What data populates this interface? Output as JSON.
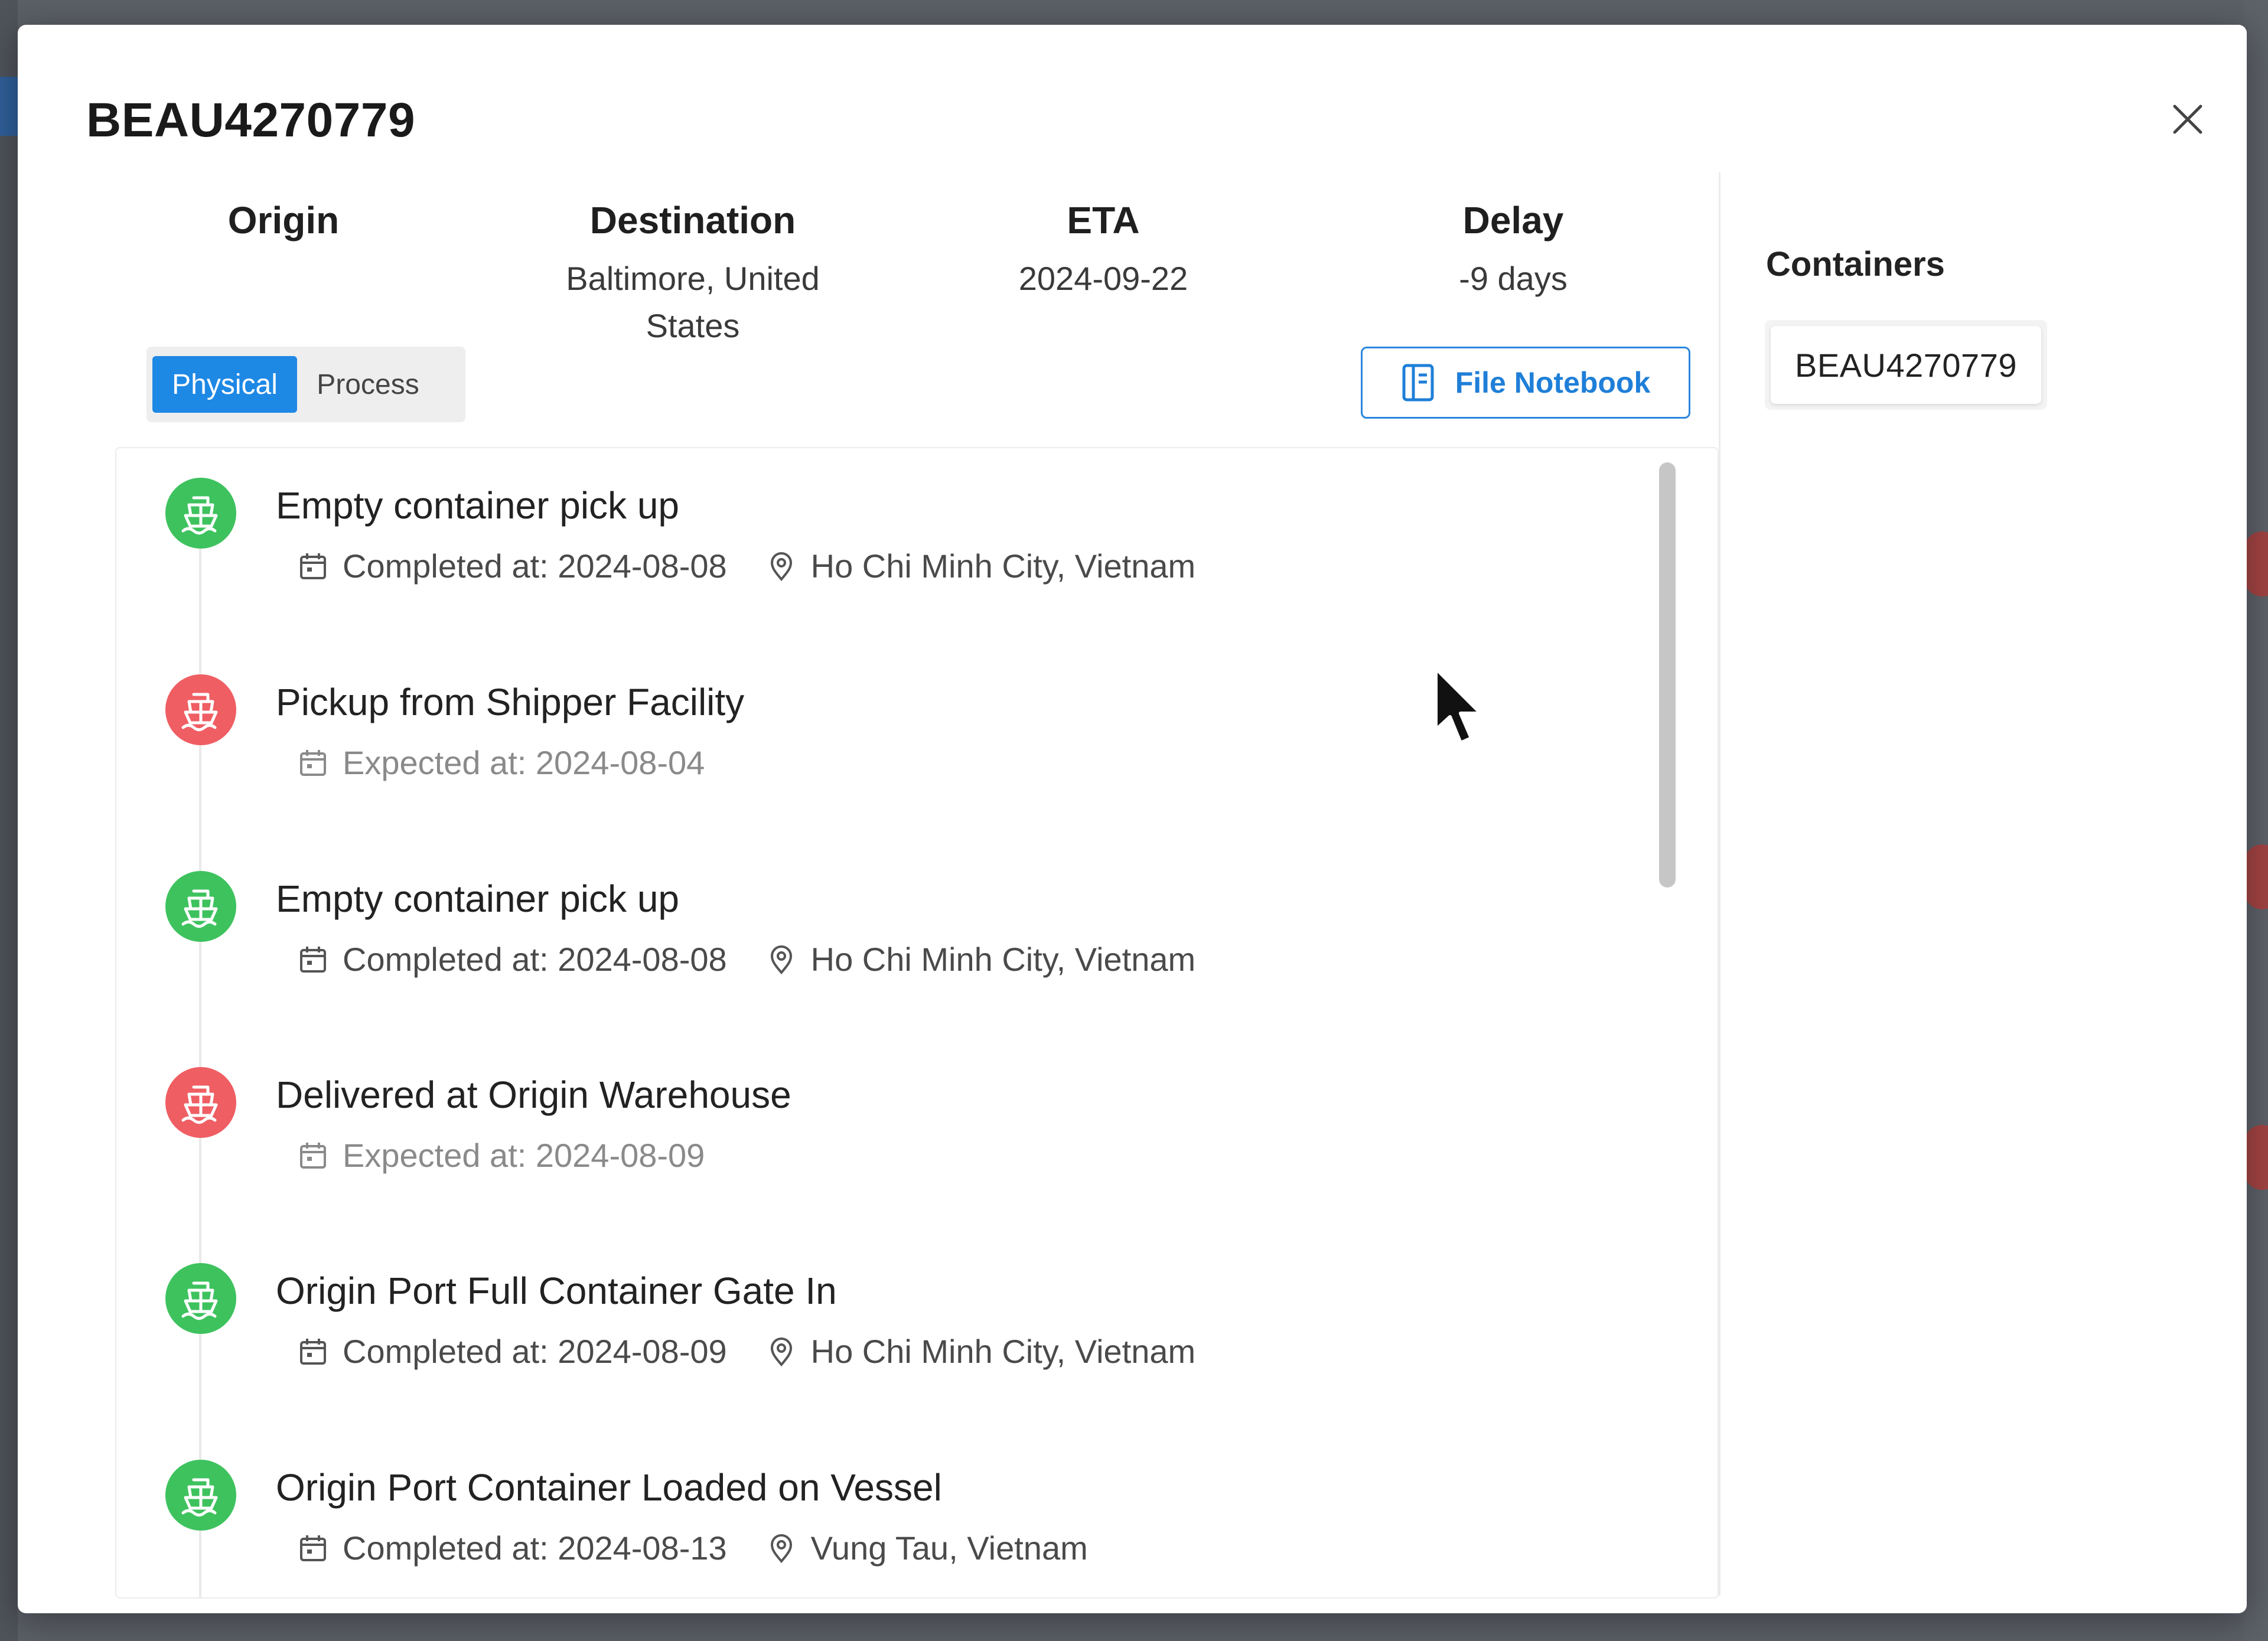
{
  "modal": {
    "title": "BEAU4270779"
  },
  "summary": {
    "origin_label": "Origin",
    "origin_value": "",
    "destination_label": "Destination",
    "destination_value_line1": "Baltimore, United",
    "destination_value_line2": "States",
    "eta_label": "ETA",
    "eta_value": "2024-09-22",
    "delay_label": "Delay",
    "delay_value": "-9 days"
  },
  "view_toggle": {
    "options": [
      "Physical",
      "Process"
    ],
    "selected": "Physical"
  },
  "file_notebook": {
    "label": "File Notebook",
    "icon": "notebook-icon"
  },
  "events": [
    {
      "title": "Empty container pick up",
      "status": "completed",
      "date_text": "Completed at: 2024-08-08",
      "location": "Ho Chi Minh City, Vietnam"
    },
    {
      "title": "Pickup from Shipper Facility",
      "status": "expected",
      "date_text": "Expected at: 2024-08-04",
      "location": ""
    },
    {
      "title": "Empty container pick up",
      "status": "completed",
      "date_text": "Completed at: 2024-08-08",
      "location": "Ho Chi Minh City, Vietnam"
    },
    {
      "title": "Delivered at Origin Warehouse",
      "status": "expected",
      "date_text": "Expected at: 2024-08-09",
      "location": ""
    },
    {
      "title": "Origin Port Full Container Gate In",
      "status": "completed",
      "date_text": "Completed at: 2024-08-09",
      "location": "Ho Chi Minh City, Vietnam"
    },
    {
      "title": "Origin Port Container Loaded on Vessel",
      "status": "completed",
      "date_text": "Completed at: 2024-08-13",
      "location": "Vung Tau, Vietnam"
    }
  ],
  "containers": {
    "label": "Containers",
    "items": [
      "BEAU4270779"
    ]
  },
  "icons": {
    "close": "close-icon",
    "event_badge": "ship-icon",
    "date": "calendar-icon",
    "location": "location-pin-icon"
  },
  "colors": {
    "accent": "#1e88e5",
    "completed": "#3ec25e",
    "expected": "#ef5e63"
  }
}
